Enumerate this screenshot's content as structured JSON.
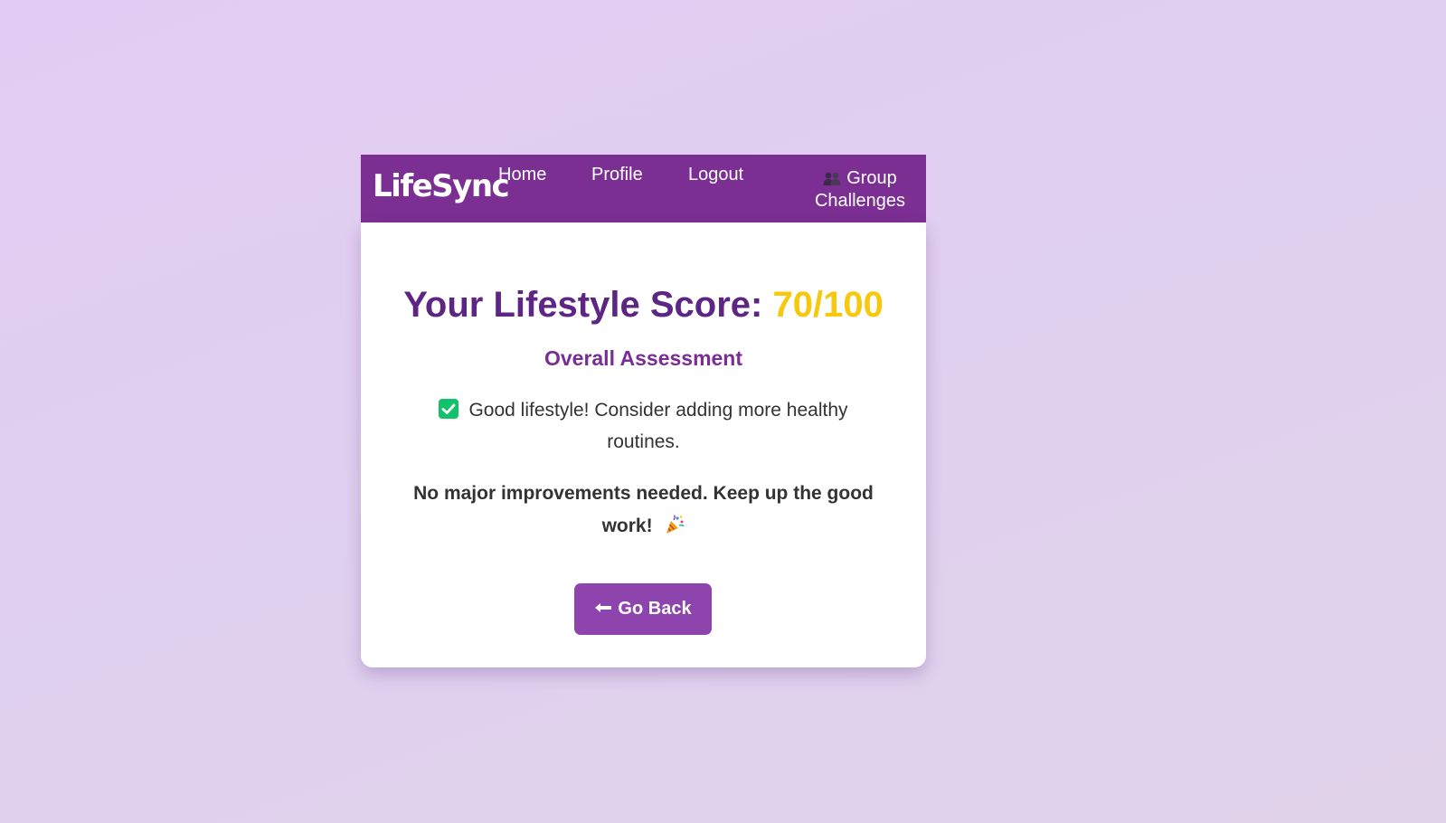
{
  "navbar": {
    "brand": "LifeSync",
    "links": {
      "home": "Home",
      "profile": "Profile",
      "logout": "Logout",
      "group_challenges_line1": "Group",
      "group_challenges_line2": "Challenges"
    },
    "group_icon": "busts-in-silhouette-icon",
    "background_color": "#7b2f93"
  },
  "score": {
    "label": "Your Lifestyle Score:",
    "value": "70/100",
    "label_color": "#5e2684",
    "value_color": "#f7c80c"
  },
  "assessment": {
    "heading": "Overall Assessment",
    "check_icon": "check-mark-icon",
    "text": "Good lifestyle! Consider adding more healthy routines.",
    "improvement_text": "No major improvements needed. Keep up the good work!",
    "celebration_icon": "party-popper-icon"
  },
  "actions": {
    "go_back_label": "Go Back",
    "go_back_icon": "left-arrow-icon",
    "button_color": "#8e44ad"
  }
}
